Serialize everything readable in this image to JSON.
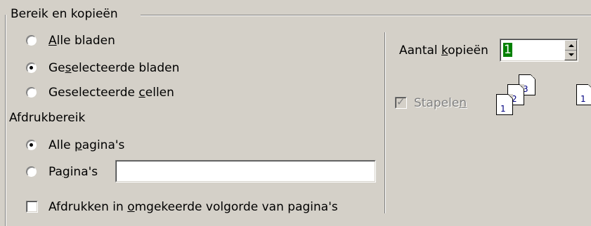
{
  "group": {
    "title": "Bereik en kopieën"
  },
  "sheets": {
    "all_sheets": "Alle bladen",
    "selected_sheets": "Geselecteerde bladen",
    "selected_cells": "Geselecteerde cellen",
    "selected": "selected_sheets"
  },
  "print_range": {
    "label": "Afdrukbereik",
    "all_pages": "Alle pagina's",
    "pages": "Pagina's",
    "pages_value": "",
    "selected": "all_pages"
  },
  "reverse_order": {
    "label": "Afdrukken in omgekeerde volgorde van pagina's",
    "checked": false
  },
  "copies": {
    "label": "Aantal kopieën",
    "value": "1"
  },
  "collate": {
    "label": "Stapelen",
    "checked": true,
    "enabled": false
  },
  "collate_pages_a": [
    "1",
    "2",
    "3"
  ],
  "collate_pages_b": [
    "1"
  ]
}
